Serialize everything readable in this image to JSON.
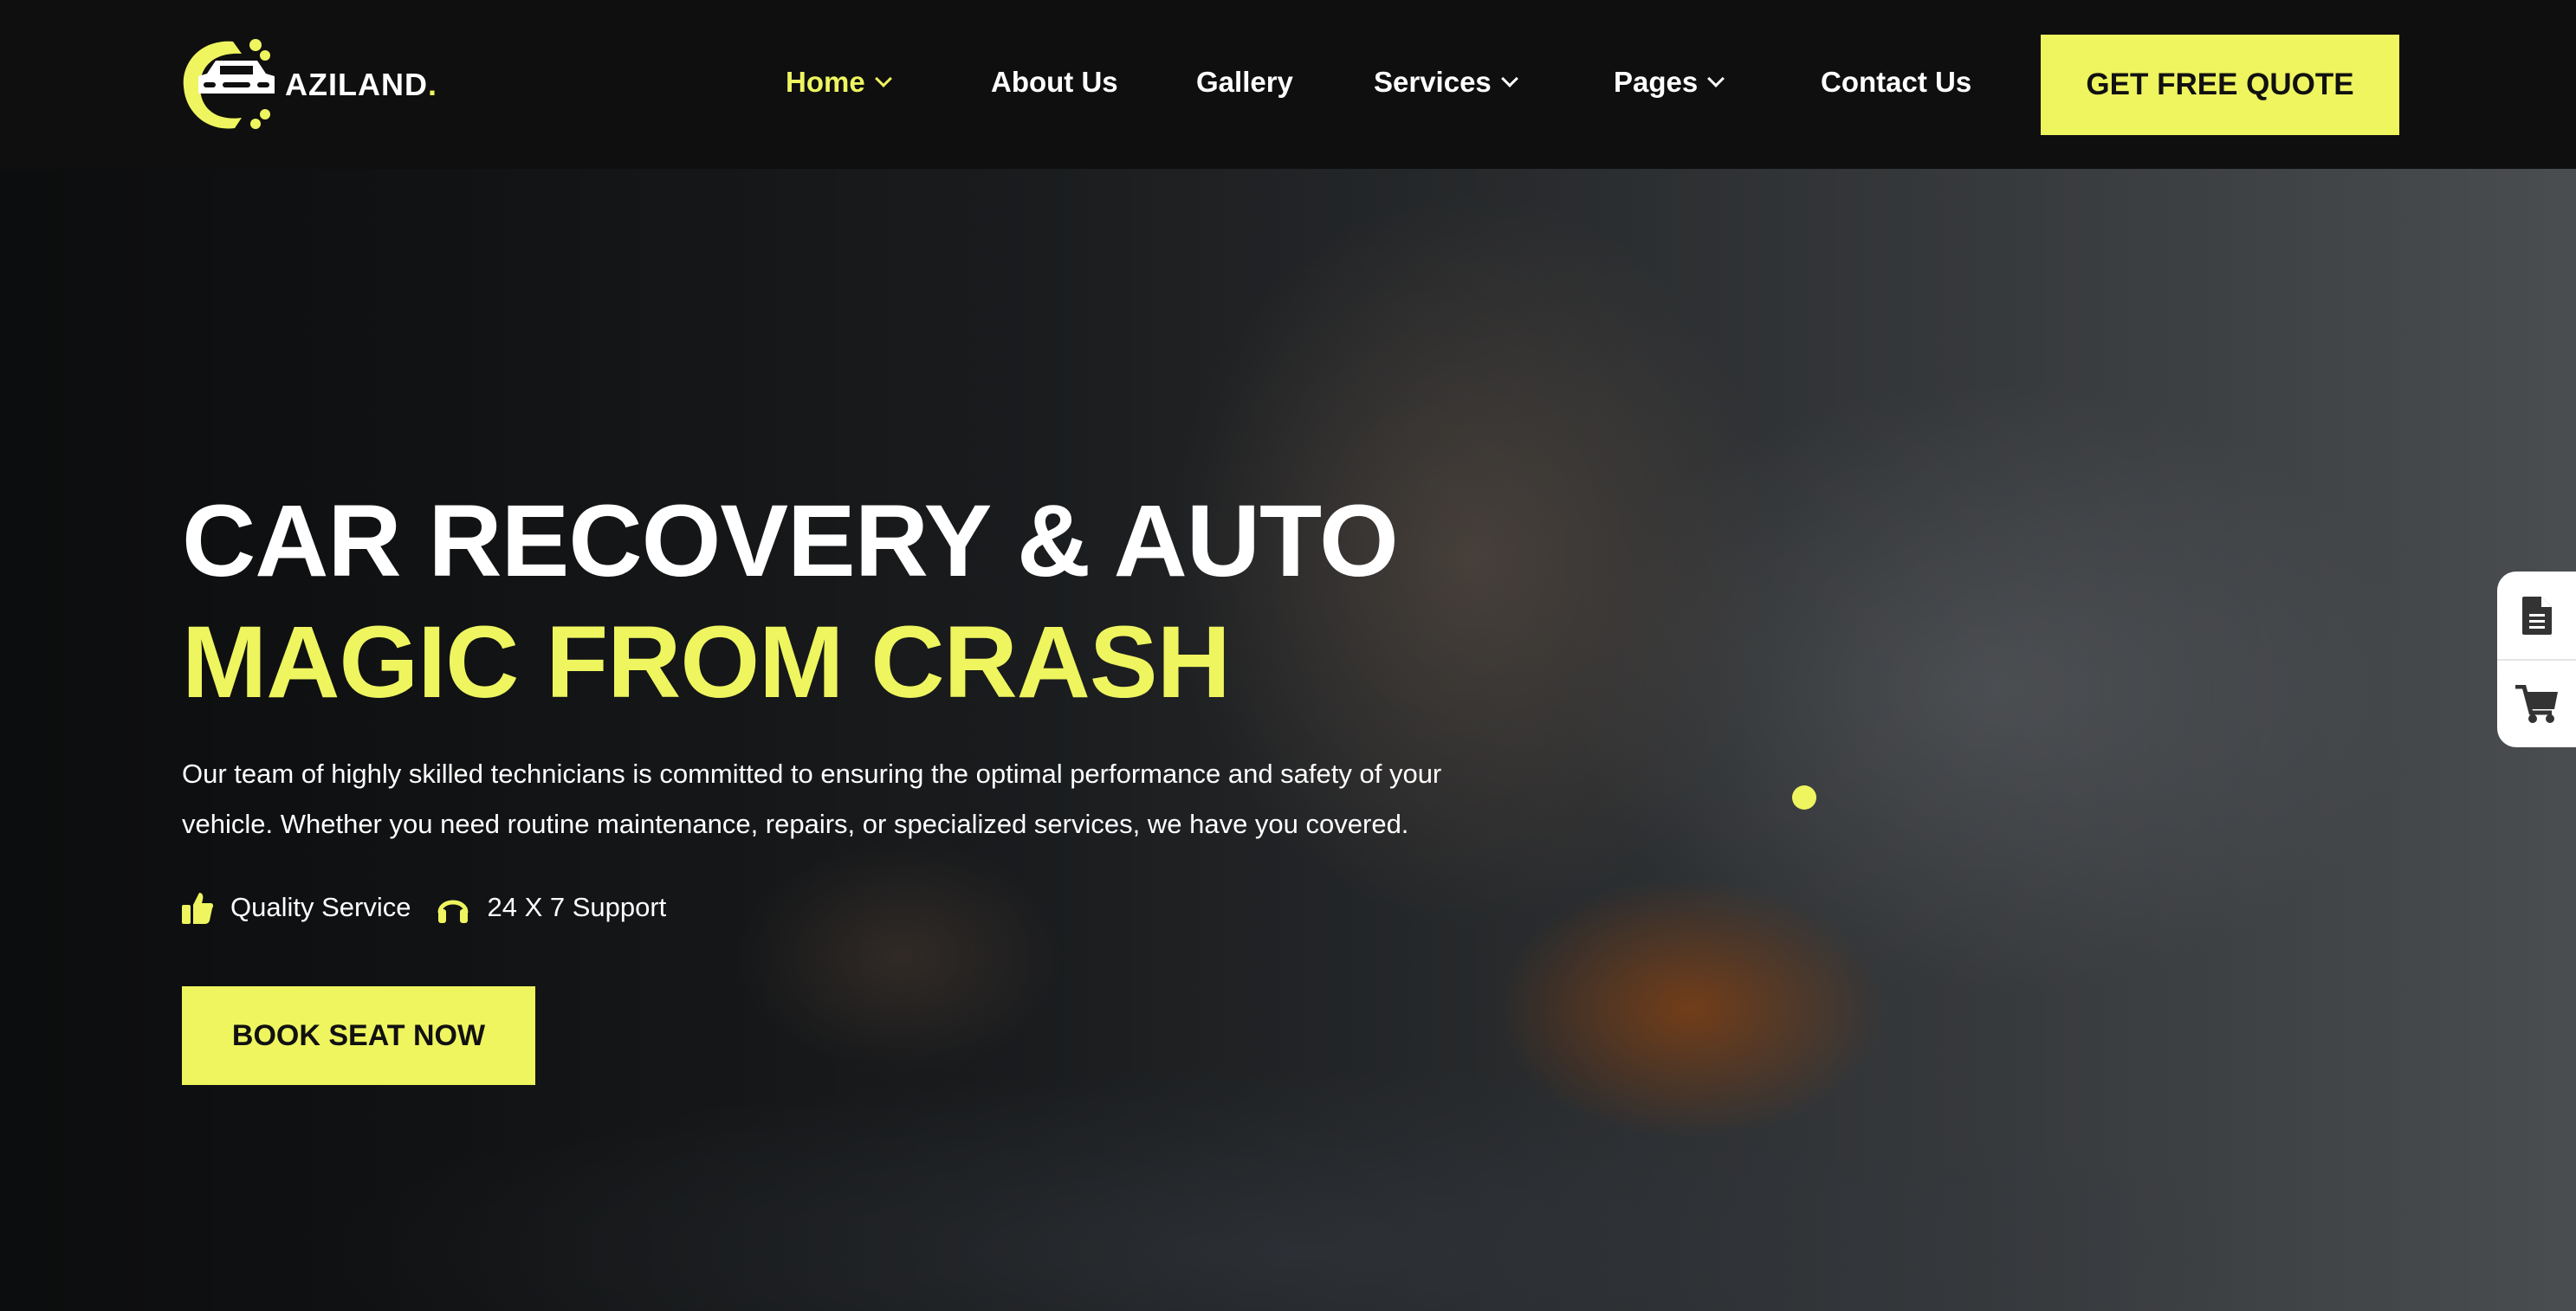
{
  "brand": {
    "name": "AZILAND",
    "dot": ".",
    "accent": "#eef55f"
  },
  "nav": {
    "items": [
      {
        "label": "Home",
        "dropdown": true,
        "active": true
      },
      {
        "label": "About Us"
      },
      {
        "label": "Gallery"
      },
      {
        "label": "Services",
        "dropdown": true
      },
      {
        "label": "Pages",
        "dropdown": true
      },
      {
        "label": "Contact Us"
      }
    ],
    "cta": "GET FREE QUOTE"
  },
  "hero": {
    "title_line1": "CAR RECOVERY & AUTO",
    "title_line2": "MAGIC FROM CRASH",
    "description": "Our team of highly skilled technicians is committed to ensuring the optimal performance and safety of your vehicle. Whether you need routine maintenance, repairs, or specialized services, we have you covered.",
    "features": [
      {
        "icon": "thumbs-up-icon",
        "label": "Quality Service"
      },
      {
        "icon": "headphones-icon",
        "label": "24 X 7 Support"
      }
    ],
    "button": "BOOK SEAT NOW"
  },
  "side_widget": {
    "icons": [
      "document-icon",
      "cart-icon"
    ]
  }
}
